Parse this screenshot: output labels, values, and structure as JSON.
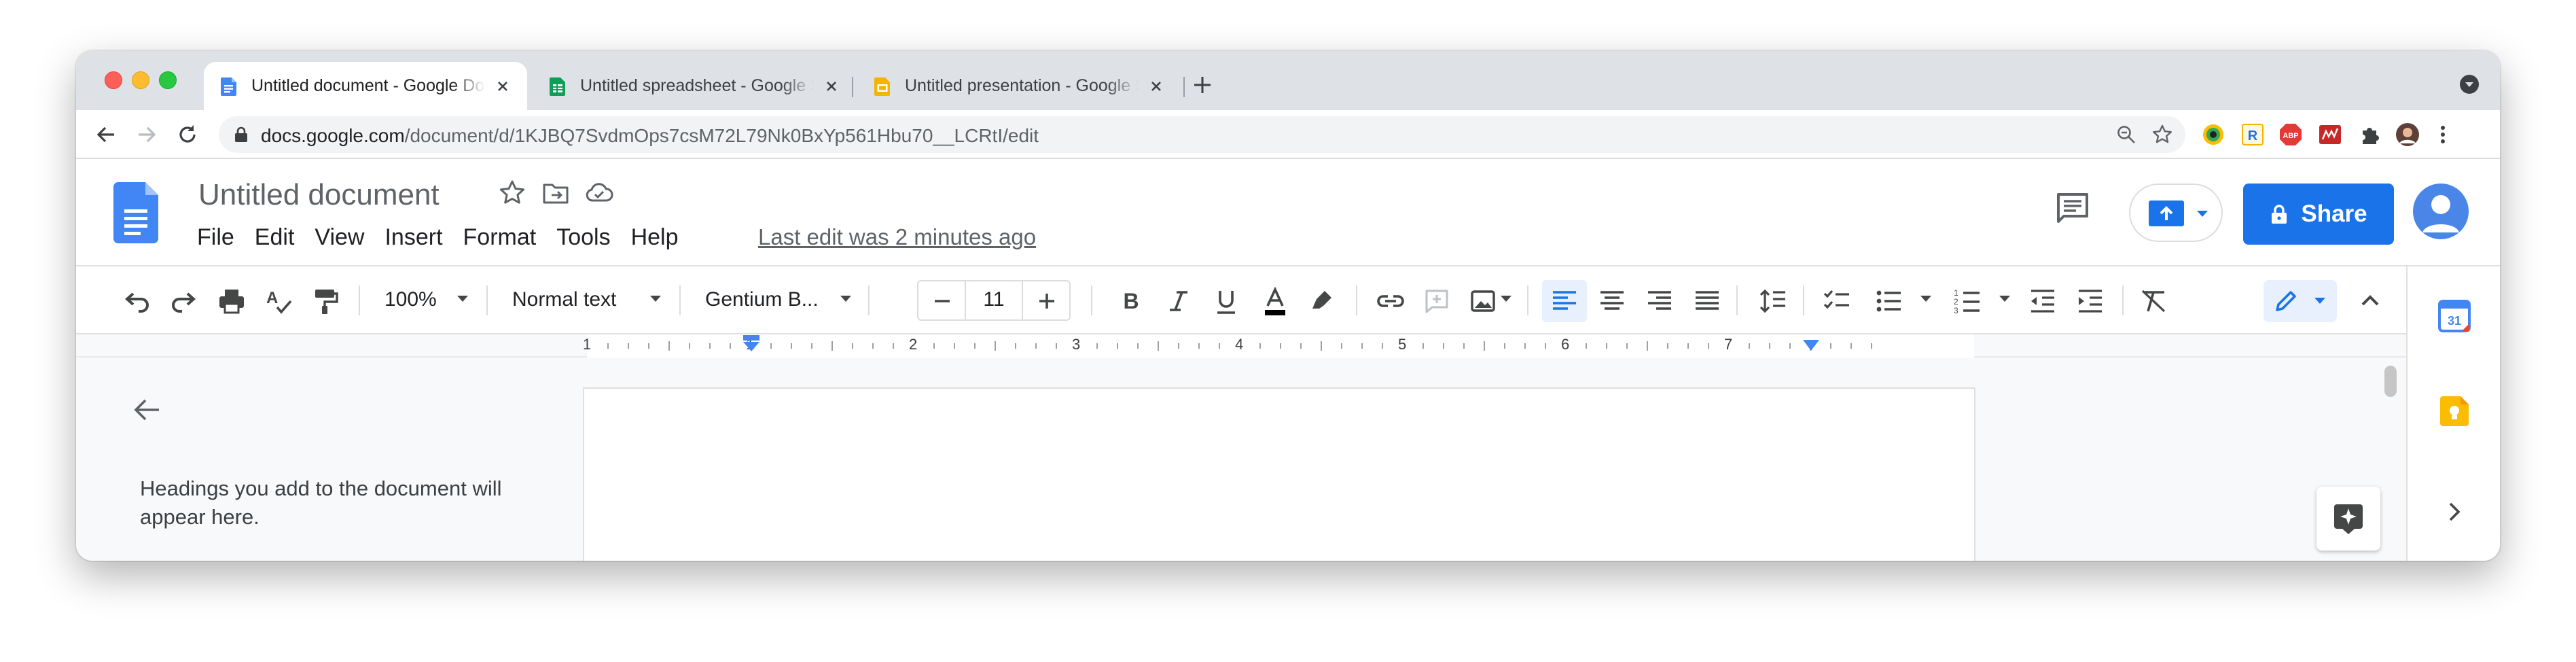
{
  "browser": {
    "tabs": [
      {
        "title": "Untitled document - Google Docs",
        "icon": "docs-icon",
        "active": true
      },
      {
        "title": "Untitled spreadsheet - Google Sheets",
        "icon": "sheets-icon",
        "active": false
      },
      {
        "title": "Untitled presentation - Google Slides",
        "icon": "slides-icon",
        "active": false
      }
    ],
    "url_host": "docs.google.com",
    "url_path": "/document/d/1KJBQ7SvdmOps7csM72L79Nk0BxYp561Hbu70__LCRtI/edit",
    "extensions": [
      "color-picker-extension-icon",
      "r-extension-icon",
      "adblock-icon",
      "extension-red-icon",
      "puzzle-extensions-icon",
      "profile-photo-icon",
      "kebab-menu-icon"
    ]
  },
  "docs": {
    "title": "Untitled document",
    "menu": [
      "File",
      "Edit",
      "View",
      "Insert",
      "Format",
      "Tools",
      "Help"
    ],
    "last_edit": "Last edit was 2 minutes ago",
    "share_label": "Share"
  },
  "toolbar": {
    "zoom": "100%",
    "style": "Normal text",
    "font": "Gentium B...",
    "font_size": "11",
    "text_color": "#000000",
    "accent": "#1a73e8"
  },
  "ruler": {
    "labels": [
      "1",
      "1",
      "2",
      "3",
      "4",
      "5",
      "6",
      "7"
    ]
  },
  "outline": {
    "empty_text": "Headings you add to the document will appear here."
  },
  "colors": {
    "docs_blue": "#4285f4",
    "share_blue": "#1a73e8",
    "sheets_green": "#0f9d58",
    "slides_yellow": "#f4b400",
    "keep_yellow": "#fbbc04"
  }
}
